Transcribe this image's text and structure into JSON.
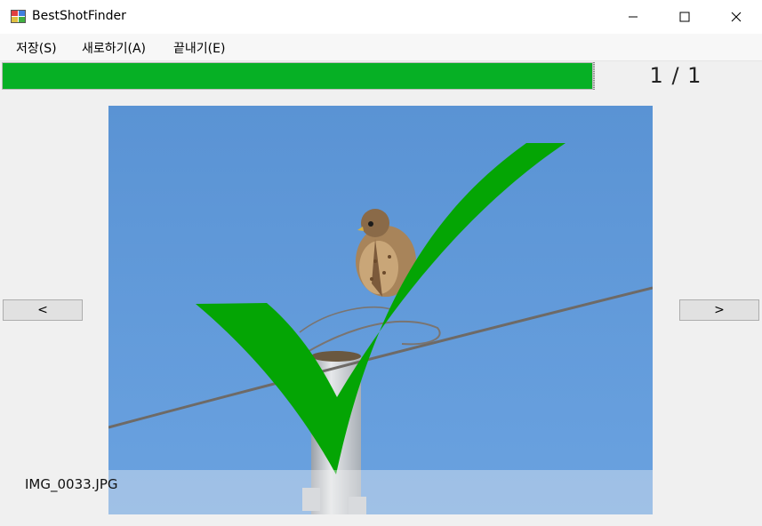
{
  "window": {
    "title": "BestShotFinder",
    "icons": {
      "app": "app-icon",
      "minimize": "minimize-icon",
      "maximize": "maximize-icon",
      "close": "close-icon"
    }
  },
  "menu": {
    "items": [
      {
        "label": "저장(S)"
      },
      {
        "label": "새로하기(A)"
      },
      {
        "label": "끝내기(E)"
      }
    ]
  },
  "progress": {
    "value": 1.0,
    "color": "#06b025"
  },
  "counter": {
    "current": "1",
    "separator": "/",
    "total": "1",
    "text": "1 / 1"
  },
  "viewer": {
    "prev_label": "<",
    "next_label": ">",
    "filename": "IMG_0033.JPG",
    "overlay": "checkmark-icon",
    "overlay_color": "#04a504",
    "sky_color": "#5f97d6"
  }
}
